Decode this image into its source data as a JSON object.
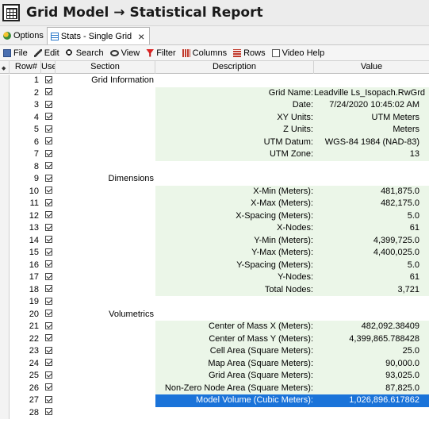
{
  "window": {
    "title": "Grid Model → Statistical Report"
  },
  "tabs": [
    {
      "label": "Options",
      "icon": "options-icon"
    },
    {
      "label": "Stats - Single Grid",
      "icon": "grid-icon",
      "active": true
    }
  ],
  "menu": [
    {
      "label": "File",
      "icon": "file-icon"
    },
    {
      "label": "Edit",
      "icon": "edit-icon"
    },
    {
      "label": "Search",
      "icon": "search-icon"
    },
    {
      "label": "View",
      "icon": "view-icon"
    },
    {
      "label": "Filter",
      "icon": "filter-icon"
    },
    {
      "label": "Columns",
      "icon": "columns-icon"
    },
    {
      "label": "Rows",
      "icon": "rows-icon"
    },
    {
      "label": "Video Help",
      "icon": "video-help-icon"
    }
  ],
  "table": {
    "columns": [
      "Row#",
      "Use",
      "Section",
      "Description",
      "Value"
    ],
    "selected_row": 27,
    "shade_color": "#ebf6e8",
    "selection_color": "#1a73d9",
    "rows": [
      {
        "row": "1",
        "section": "Grid Information",
        "description": "",
        "value": ""
      },
      {
        "row": "2",
        "section": "",
        "description": "Grid Name:",
        "value": "Leadville Ls_Isopach.RwGrd"
      },
      {
        "row": "3",
        "section": "",
        "description": "Date:",
        "value": "7/24/2020 10:45:02 AM"
      },
      {
        "row": "4",
        "section": "",
        "description": "XY Units:",
        "value": "UTM Meters"
      },
      {
        "row": "5",
        "section": "",
        "description": "Z Units:",
        "value": "Meters"
      },
      {
        "row": "6",
        "section": "",
        "description": "UTM Datum:",
        "value": "WGS-84 1984 (NAD-83)"
      },
      {
        "row": "7",
        "section": "",
        "description": "UTM Zone:",
        "value": "13"
      },
      {
        "row": "8",
        "section": "",
        "description": "",
        "value": ""
      },
      {
        "row": "9",
        "section": "Dimensions",
        "description": "",
        "value": ""
      },
      {
        "row": "10",
        "section": "",
        "description": "X-Min (Meters):",
        "value": "481,875.0"
      },
      {
        "row": "11",
        "section": "",
        "description": "X-Max (Meters):",
        "value": "482,175.0"
      },
      {
        "row": "12",
        "section": "",
        "description": "X-Spacing (Meters):",
        "value": "5.0"
      },
      {
        "row": "13",
        "section": "",
        "description": "X-Nodes:",
        "value": "61"
      },
      {
        "row": "14",
        "section": "",
        "description": "Y-Min (Meters):",
        "value": "4,399,725.0"
      },
      {
        "row": "15",
        "section": "",
        "description": "Y-Max (Meters):",
        "value": "4,400,025.0"
      },
      {
        "row": "16",
        "section": "",
        "description": "Y-Spacing (Meters):",
        "value": "5.0"
      },
      {
        "row": "17",
        "section": "",
        "description": "Y-Nodes:",
        "value": "61"
      },
      {
        "row": "18",
        "section": "",
        "description": "Total Nodes:",
        "value": "3,721"
      },
      {
        "row": "19",
        "section": "",
        "description": "",
        "value": ""
      },
      {
        "row": "20",
        "section": "Volumetrics",
        "description": "",
        "value": ""
      },
      {
        "row": "21",
        "section": "",
        "description": "Center of Mass X (Meters):",
        "value": "482,092.38409"
      },
      {
        "row": "22",
        "section": "",
        "description": "Center of Mass Y (Meters):",
        "value": "4,399,865.788428"
      },
      {
        "row": "23",
        "section": "",
        "description": "Cell Area (Square Meters):",
        "value": "25.0"
      },
      {
        "row": "24",
        "section": "",
        "description": "Map Area (Square Meters):",
        "value": "90,000.0"
      },
      {
        "row": "25",
        "section": "",
        "description": "Grid Area (Square Meters):",
        "value": "93,025.0"
      },
      {
        "row": "26",
        "section": "",
        "description": "Non-Zero Node Area (Square Meters):",
        "value": "87,825.0"
      },
      {
        "row": "27",
        "section": "",
        "description": "Model Volume (Cubic Meters):",
        "value": "1,026,896.617862"
      },
      {
        "row": "28",
        "section": "",
        "description": "",
        "value": ""
      }
    ]
  }
}
